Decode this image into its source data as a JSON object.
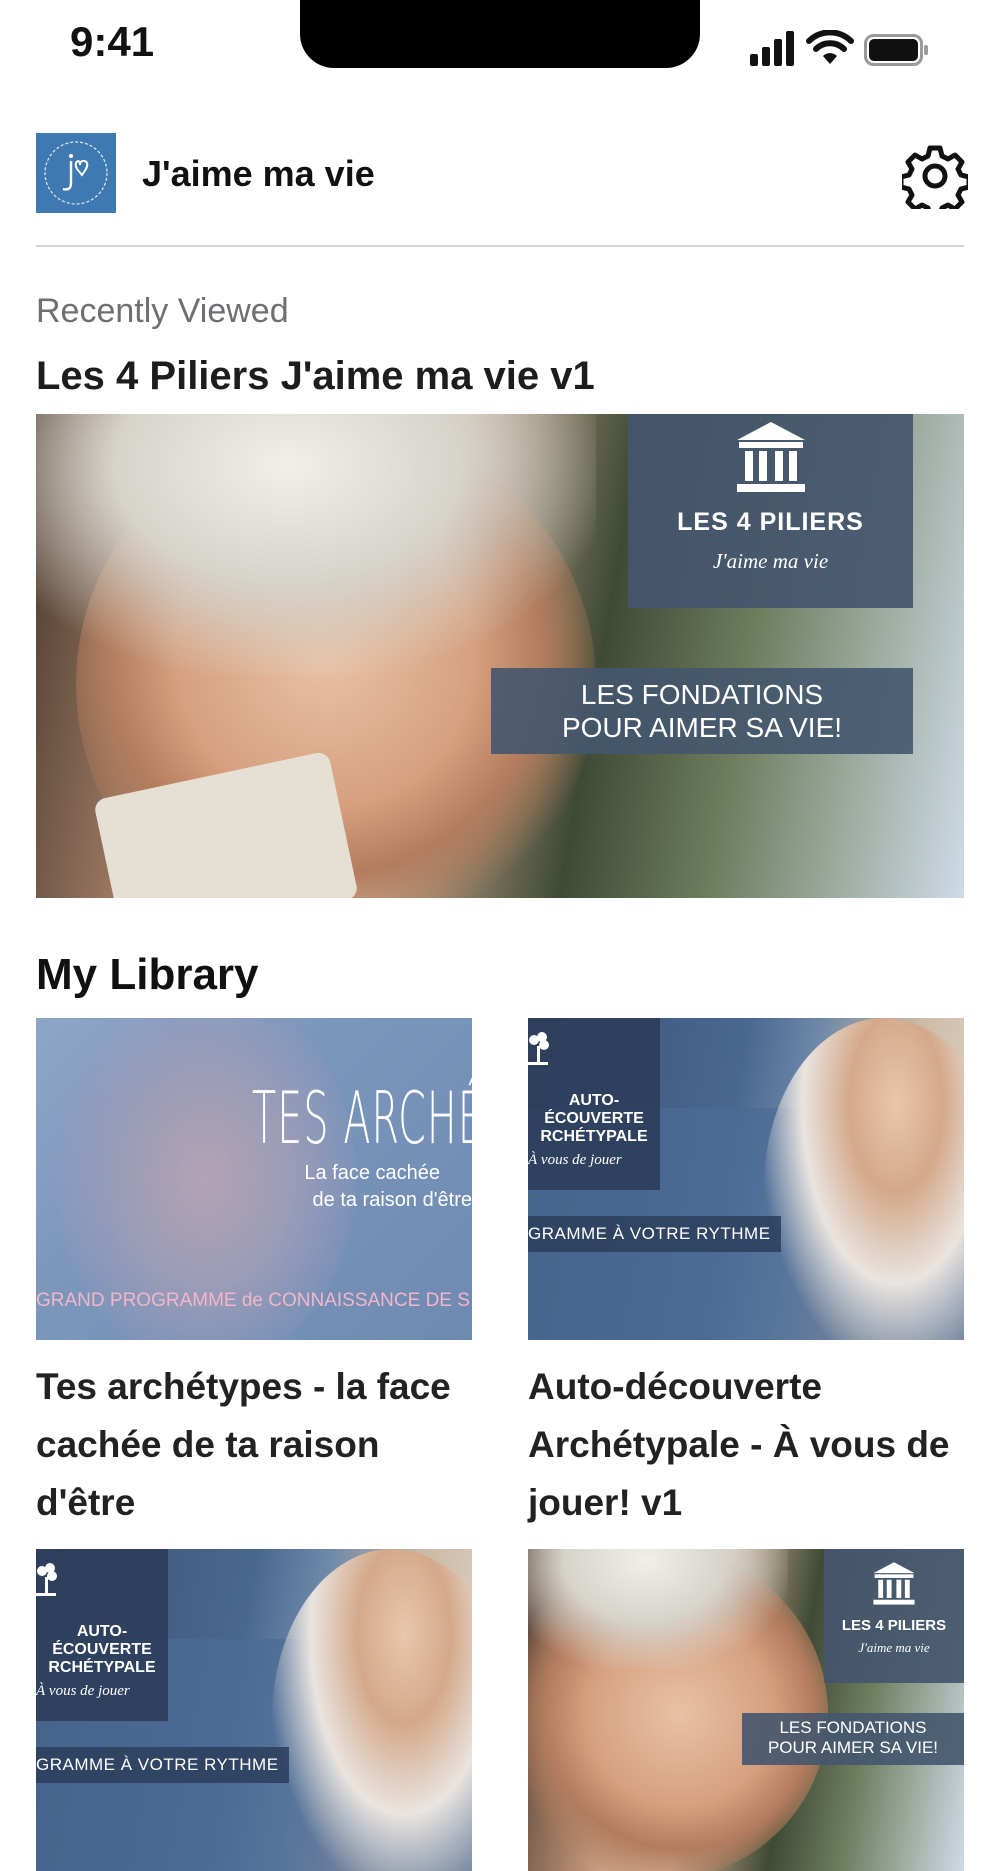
{
  "status_bar": {
    "time": "9:41"
  },
  "header": {
    "app_title": "J'aime ma vie"
  },
  "recently_viewed": {
    "section_label": "Recently Viewed",
    "title": "Les 4 Piliers J'aime ma vie v1",
    "hero": {
      "badge_title": "LES 4 PILIERS",
      "badge_subtitle": "J'aime ma vie",
      "banner_line1": "LES FONDATIONS",
      "banner_line2": "POUR AIMER SA VIE!"
    }
  },
  "library": {
    "title": "My Library",
    "items": [
      {
        "title": "Tes archétypes - la face cachée de ta raison d'être",
        "thumb_title": "TES ARCHÉTY",
        "thumb_sub_line1": "La face cachée",
        "thumb_sub_line2": "de ta raison d'être",
        "thumb_strip": "GRAND PROGRAMME de CONNAISSANCE DE S"
      },
      {
        "title": "Auto-découverte Archétypale - À vous de jouer! v1",
        "badge_title": "AUTO-\nÉCOUVERTE\nRCHÉTYPALE",
        "badge_sub": "À vous de jouer",
        "strip": "GRAMME À VOTRE RYTHME"
      },
      {
        "badge_title": "AUTO-\nÉCOUVERTE\nRCHÉTYPALE",
        "badge_sub": "À vous de jouer",
        "strip": "GRAMME À VOTRE RYTHME"
      },
      {
        "badge_title": "LES 4 PILIERS",
        "badge_sub": "J'aime ma vie",
        "banner_line1": "LES FONDATIONS",
        "banner_line2": "POUR AIMER SA VIE!"
      }
    ]
  },
  "colors": {
    "logo_bg": "#3f79b1",
    "badge_bg": "#44566e",
    "divider": "#d4d4d6"
  },
  "icons": [
    "signal-icon",
    "wifi-icon",
    "battery-icon",
    "settings-gear-icon",
    "pillar-building-icon",
    "tree-icon"
  ]
}
